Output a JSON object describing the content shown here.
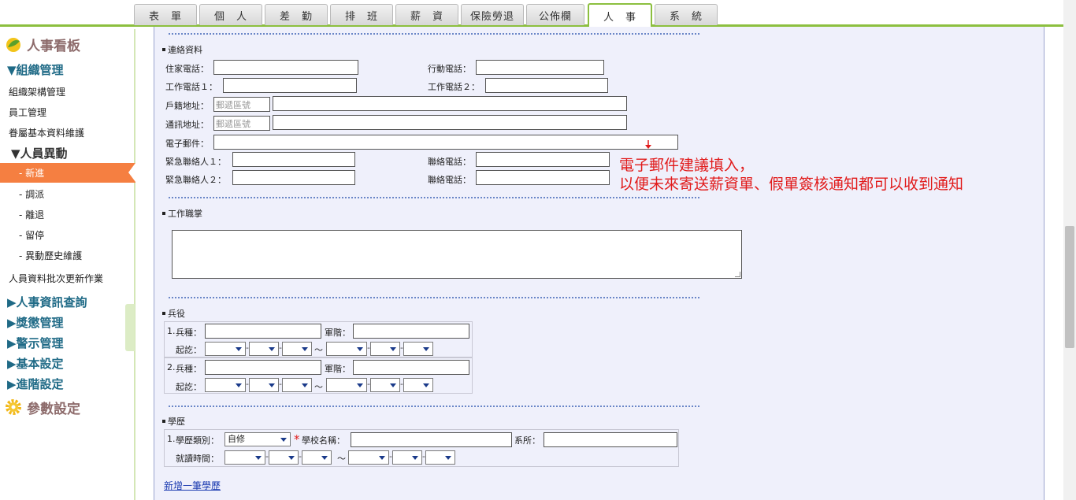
{
  "tabs": [
    "表　單",
    "個　人",
    "差　勤",
    "排　班",
    "薪　資",
    "保險勞退",
    "公佈欄",
    "人　事",
    "系　統"
  ],
  "sidebar": {
    "board_title": "人事看板",
    "org_section": "▼組織管理",
    "org_items": [
      "組織架構管理",
      "員工管理",
      "眷屬基本資料維護"
    ],
    "change_section": "▼人員異動",
    "change_items": [
      "- 新進",
      "- 調派",
      "- 離退",
      "- 留停",
      "- 異動歷史維護"
    ],
    "batch_item": "人員資料批次更新作業",
    "collapsed_sections": [
      "▶人事資訊查詢",
      "▶獎懲管理",
      "▶警示管理",
      "▶基本設定",
      "▶進階設定"
    ],
    "param_title": "參數設定"
  },
  "contact": {
    "title": "連絡資料",
    "home_phone": "住家電話：",
    "mobile_phone": "行動電話：",
    "work_phone1": "工作電話１：",
    "work_phone2": "工作電話２：",
    "reg_address": "戶籍地址：",
    "mail_address": "通訊地址：",
    "zip_placeholder": "郵遞區號",
    "email": "電子郵件：",
    "emergency1": "緊急聯絡人１：",
    "emergency2": "緊急聯絡人２：",
    "contact_phone": "聯絡電話："
  },
  "note": {
    "line1": "電子郵件建議填入，",
    "line2": "以便未來寄送薪資單、假單簽核通知都可以收到通知"
  },
  "duty": {
    "title": "工作職掌"
  },
  "military": {
    "title": "兵役",
    "row1_no": "1.",
    "row2_no": "2.",
    "type": "兵種：",
    "rank": "軍階：",
    "period": "起訖：",
    "tilde": "～"
  },
  "education": {
    "title": "學歷",
    "row1_no": "1.",
    "type": "學歷類別：",
    "type_value": "自修",
    "required_mark": "*",
    "school": "學校名稱：",
    "dept": "系所：",
    "period": "就讀時間：",
    "tilde": "～",
    "add_link": "新增一筆學歷"
  }
}
